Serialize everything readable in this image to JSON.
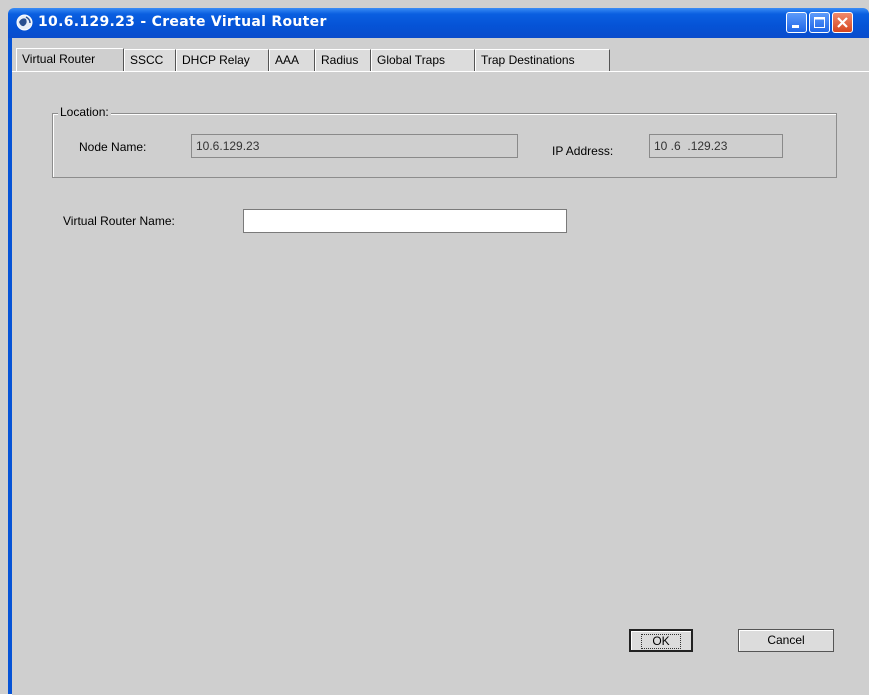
{
  "window": {
    "title": "10.6.129.23 - Create Virtual Router"
  },
  "tabs": [
    {
      "label": "Virtual Router",
      "active": true
    },
    {
      "label": "SSCC",
      "active": false
    },
    {
      "label": "DHCP Relay",
      "active": false
    },
    {
      "label": "AAA",
      "active": false
    },
    {
      "label": "Radius",
      "active": false
    },
    {
      "label": "Global Traps",
      "active": false
    },
    {
      "label": "Trap Destinations",
      "active": false
    }
  ],
  "location": {
    "legend": "Location:",
    "node_name_label": "Node Name:",
    "node_name_value": "10.6.129.23",
    "ip_address_label": "IP Address:",
    "ip_address_value": "10 .6  .129.23"
  },
  "form": {
    "vr_name_label": "Virtual Router Name:",
    "vr_name_value": ""
  },
  "buttons": {
    "ok_label": "OK",
    "cancel_label": "Cancel"
  },
  "colors": {
    "titlebar": "#0553d6",
    "close_button": "#d6451f",
    "panel_background": "#cfcfcf"
  }
}
